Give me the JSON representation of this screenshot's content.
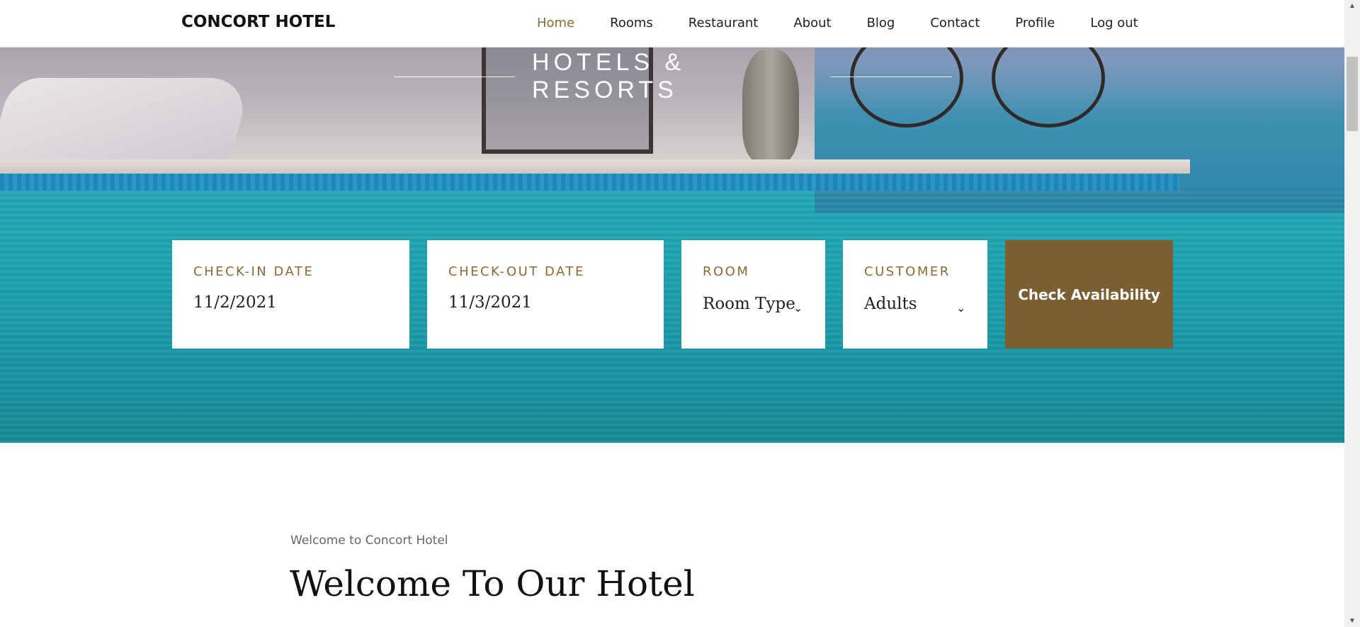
{
  "header": {
    "brand": "CONCORT HOTEL",
    "nav": [
      {
        "label": "Home",
        "active": true
      },
      {
        "label": "Rooms"
      },
      {
        "label": "Restaurant"
      },
      {
        "label": "About"
      },
      {
        "label": "Blog"
      },
      {
        "label": "Contact"
      },
      {
        "label": "Profile"
      },
      {
        "label": "Log out"
      }
    ]
  },
  "hero": {
    "tagline": "HOTELS & RESORTS"
  },
  "booking": {
    "checkin_label": "CHECK-IN DATE",
    "checkin_value": "11/2/2021",
    "checkout_label": "CHECK-OUT DATE",
    "checkout_value": "11/3/2021",
    "room_label": "ROOM",
    "room_value": "Room Type",
    "customer_label": "CUSTOMER",
    "customer_value": "Adults",
    "button_label": "Check Availability"
  },
  "welcome": {
    "subtitle": "Welcome to Concort Hotel",
    "title": "Welcome To Our Hotel"
  },
  "colors": {
    "accent": "#8a6a35",
    "button_bg": "#7a5f33"
  },
  "icons": {
    "dropdown": "chevron-down-icon",
    "scroll_up": "scroll-up-arrow-icon",
    "scroll_down": "scroll-down-arrow-icon"
  }
}
